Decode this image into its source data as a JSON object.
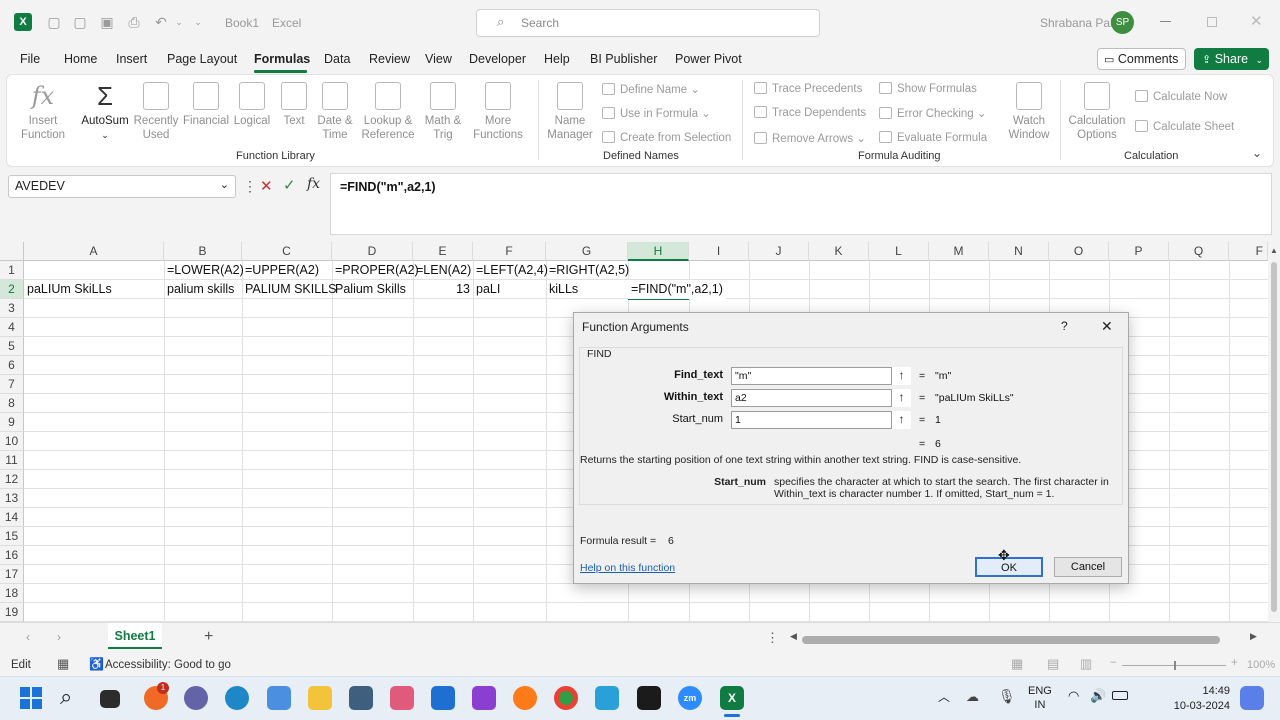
{
  "titlebar": {
    "doc_name": "Book1",
    "app_name": "Excel",
    "search_placeholder": "Search",
    "user_name": "Shrabana Pal",
    "user_initials": "SP"
  },
  "menu": [
    "File",
    "Home",
    "Insert",
    "Page Layout",
    "Formulas",
    "Data",
    "Review",
    "View",
    "Developer",
    "Help",
    "BI Publisher",
    "Power Pivot"
  ],
  "menu_active": "Formulas",
  "comments_label": "Comments",
  "share_label": "Share",
  "ribbon": {
    "function_library": {
      "label": "Function Library",
      "insert_function": [
        "Insert",
        "Function"
      ],
      "autosum": "AutoSum",
      "recently_used": [
        "Recently",
        "Used"
      ],
      "financial": "Financial",
      "logical": "Logical",
      "text": "Text",
      "date_time": [
        "Date &",
        "Time"
      ],
      "lookup": [
        "Lookup &",
        "Reference"
      ],
      "math": [
        "Math &",
        "Trig"
      ],
      "more": [
        "More",
        "Functions"
      ]
    },
    "defined_names": {
      "label": "Defined Names",
      "name_manager": [
        "Name",
        "Manager"
      ],
      "define_name": "Define Name",
      "use_in_formula": "Use in Formula",
      "create_from_selection": "Create from Selection"
    },
    "formula_auditing": {
      "label": "Formula Auditing",
      "trace_precedents": "Trace Precedents",
      "trace_dependents": "Trace Dependents",
      "remove_arrows": "Remove Arrows",
      "show_formulas": "Show Formulas",
      "error_checking": "Error Checking",
      "evaluate_formula": "Evaluate Formula",
      "watch_window": [
        "Watch",
        "Window"
      ]
    },
    "calculation": {
      "label": "Calculation",
      "calculation_options": [
        "Calculation",
        "Options"
      ],
      "calculate_now": "Calculate Now",
      "calculate_sheet": "Calculate Sheet"
    }
  },
  "formula_bar": {
    "name_box": "AVEDEV",
    "fx": "fx",
    "formula": "=FIND(\"m\",a2,1)"
  },
  "columns": [
    "A",
    "B",
    "C",
    "D",
    "E",
    "F",
    "G",
    "H",
    "I",
    "J",
    "K",
    "L",
    "M",
    "N",
    "O",
    "P",
    "Q",
    "F"
  ],
  "rows": [
    "1",
    "2",
    "3",
    "4",
    "5",
    "6",
    "7",
    "8",
    "9",
    "10",
    "11",
    "12",
    "13",
    "14",
    "15",
    "16",
    "17",
    "18",
    "19"
  ],
  "cells": {
    "B1": "=LOWER(A2)",
    "C1": "=UPPER(A2)",
    "D1": "=PROPER(A2)",
    "E1": "=LEN(A2)",
    "F1": "=LEFT(A2,4)",
    "G1": "=RIGHT(A2,5)",
    "A2": "paLIUm SkiLLs",
    "B2": "palium skills",
    "C2": "PALIUM SKILLS",
    "D2": "Palium Skills",
    "E2": "13",
    "F2": "paLI",
    "G2": "kiLLs",
    "H2": "=FIND(\"m\",a2,1)"
  },
  "sheet_tab": "Sheet1",
  "status": {
    "mode": "Edit",
    "accessibility": "Accessibility: Good to go",
    "zoom": "100%"
  },
  "dialog": {
    "title": "Function Arguments",
    "help_glyph": "?",
    "function_name": "FIND",
    "args": [
      {
        "label": "Find_text",
        "input": "\"m\"",
        "value": "\"m\""
      },
      {
        "label": "Within_text",
        "input": "a2",
        "value": "\"paLIUm SkiLLs\""
      },
      {
        "label": "Start_num",
        "input": "1",
        "value": "1"
      }
    ],
    "result_value": "6",
    "description": "Returns the starting position of one text string within another text string. FIND is case-sensitive.",
    "arg_help_name": "Start_num",
    "arg_help_text": "specifies the character at which to start the search. The first character in Within_text is character number 1. If omitted, Start_num = 1.",
    "formula_result_label": "Formula result =",
    "formula_result_value": "6",
    "help_link": "Help on this function",
    "ok_label": "OK",
    "cancel_label": "Cancel"
  },
  "taskbar": {
    "lang": "ENG",
    "lang2": "IN",
    "time": "14:49",
    "date": "10-03-2024",
    "badge": "1"
  }
}
